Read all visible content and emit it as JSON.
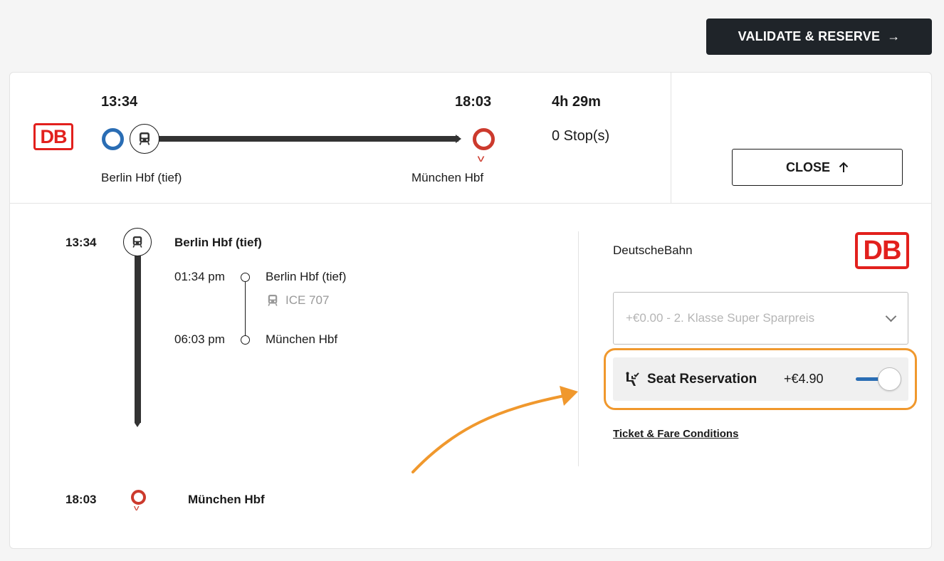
{
  "header": {
    "validate_label": "VALIDATE & RESERVE",
    "arrow_icon": "arrow-right-icon"
  },
  "summary": {
    "operator_logo_text": "DB",
    "departure_time": "13:34",
    "arrival_time": "18:03",
    "origin": "Berlin Hbf (tief)",
    "destination": "München Hbf",
    "duration": "4h 29m",
    "stops": "0 Stop(s)",
    "close_label": "CLOSE"
  },
  "itinerary": {
    "start_time": "13:34",
    "start_station": "Berlin Hbf (tief)",
    "leg": {
      "dep_time": "01:34 pm",
      "dep_station": "Berlin Hbf (tief)",
      "train": "ICE 707",
      "arr_time": "06:03 pm",
      "arr_station": "München Hbf"
    },
    "end_time": "18:03",
    "end_station": "München Hbf"
  },
  "fare": {
    "operator_name": "DeutscheBahn",
    "logo_text": "DB",
    "selected_fare": "+€0.00 - 2. Klasse Super Sparpreis",
    "seat_label": "Seat Reservation",
    "seat_price": "+€4.90",
    "seat_enabled": true,
    "conditions_link": "Ticket & Fare Conditions"
  },
  "colors": {
    "accent_blue": "#2a6db4",
    "destination_red": "#cc3a2d",
    "db_red": "#e2201d",
    "highlight_orange": "#f0982d",
    "dark_button": "#1f2429"
  }
}
